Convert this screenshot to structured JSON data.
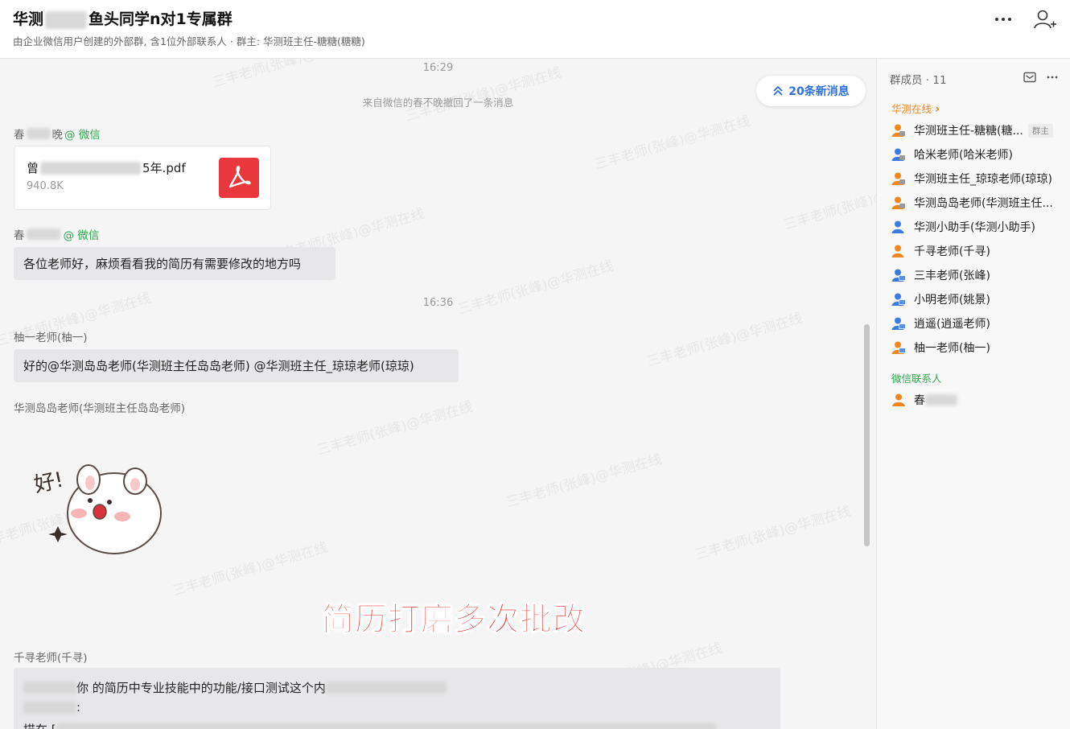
{
  "header": {
    "title_prefix": "华测",
    "title_suffix": "鱼头同学n对1专属群",
    "subtitle": "由企业微信用户创建的外部群, 含1位外部联系人 · 群主: 华测班主任-糖糖(糖糖)"
  },
  "chat": {
    "time_1": "16:29",
    "recall_notice": "来自微信的春不晚撤回了一条消息",
    "new_messages": "20条新消息",
    "msg1": {
      "sender_prefix": "春",
      "sender_suffix": "晚",
      "sender_source": "@ 微信",
      "file_name_prefix": "曾",
      "file_name_suffix": "5年.pdf",
      "file_size": "940.8K"
    },
    "msg2": {
      "sender_prefix": "春",
      "sender_source": "@ 微信",
      "text": "各位老师好，麻烦看看我的简历有需要修改的地方吗"
    },
    "time_2": "16:36",
    "msg3": {
      "sender": "柚一老师(柚一)",
      "text": "好的@华测岛岛老师(华测班主任岛岛老师) @华测班主任_琼琼老师(琼琼)"
    },
    "msg4": {
      "sender": "华测岛岛老师(华测班主任岛岛老师)",
      "sticker_text": "好!"
    },
    "overlay_caption": "简历打磨多次批改",
    "msg5": {
      "sender": "千寻老师(千寻)",
      "line1_text": "你 的简历中专业技能中的功能/接口测试这个内",
      "line2_text": ":",
      "line3_text": "描在 ["
    },
    "watermark": "三丰老师(张峰)@华测在线"
  },
  "sidepanel": {
    "members_title": "群成员 · 11",
    "group_internal": "华测在线",
    "group_internal_chevron": "›",
    "owner_badge": "群主",
    "members": [
      {
        "name": "华测班主任-糖糖(糖..."
      },
      {
        "name": "哈米老师(哈米老师)"
      },
      {
        "name": "华测班主任_琼琼老师(琼琼)"
      },
      {
        "name": "华测岛岛老师(华测班主任..."
      },
      {
        "name": "华测小助手(华测小助手)"
      },
      {
        "name": "千寻老师(千寻)"
      },
      {
        "name": "三丰老师(张峰)"
      },
      {
        "name": "小明老师(姚景)"
      },
      {
        "name": "逍遥(逍遥老师)"
      },
      {
        "name": "柚一老师(柚一)"
      }
    ],
    "group_wechat": "微信联系人",
    "external_prefix": "春"
  },
  "colors": {
    "accent_blue": "#2f6fde",
    "wechat_green": "#2ba84a",
    "org_orange": "#f0871e",
    "pdf_red": "#e8383d",
    "caption_red": "#e53935"
  }
}
